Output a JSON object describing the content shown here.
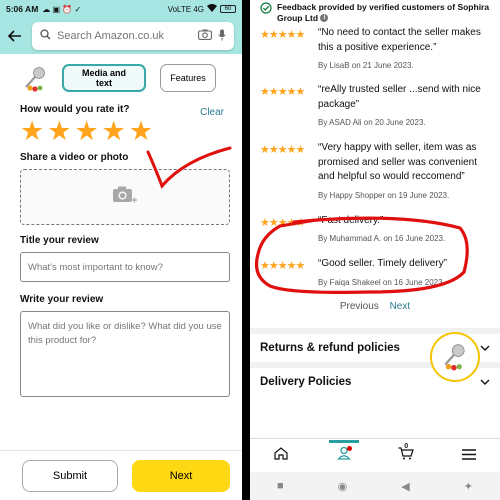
{
  "left": {
    "status": {
      "time": "5:06 AM",
      "left_icons": "☁ ▣ ⏰ ✓",
      "network": "VoLTE 4G",
      "battery": "60"
    },
    "search": {
      "placeholder": "Search Amazon.co.uk"
    },
    "tabs": [
      {
        "label": "Media and text",
        "active": true
      },
      {
        "label": "Features",
        "active": false
      }
    ],
    "rating": {
      "question": "How would you rate it?",
      "stars": 5,
      "clear_label": "Clear"
    },
    "upload": {
      "label": "Share a video or photo"
    },
    "title_field": {
      "label": "Title your review",
      "placeholder": "What's most important to know?"
    },
    "review_field": {
      "label": "Write your review",
      "placeholder": "What did you like or dislike? What did you use this product for?"
    },
    "buttons": {
      "submit": "Submit",
      "next": "Next"
    },
    "annotation_color": "#e0100f"
  },
  "right": {
    "feedback_header": "Feedback provided by verified customers of Sophira Group Ltd",
    "reviews": [
      {
        "stars": "★★★★★",
        "text": "“No need to contact the seller makes this a positive experience.”",
        "by": "By LisaB on 21 June 2023."
      },
      {
        "stars": "★★★★★",
        "text": "“reAlly trusted seller ...send with nice package”",
        "by": "By ASAD Ali on 20 June 2023."
      },
      {
        "stars": "★★★★★",
        "text": "“Very happy with seller, item was as promised and seller was convenient and helpful so would reccomend”",
        "by": "By Happy Shopper on 19 June 2023."
      },
      {
        "stars": "★★★★★",
        "text": "“Fast delivery.”",
        "by": "By Muhammad A. on 16 June 2023."
      },
      {
        "stars": "★★★★★",
        "text": "“Good seller. Timely delivery”",
        "by": "By Faiqa Shakeel on 16 June 2023."
      }
    ],
    "pager": {
      "previous": "Previous",
      "next": "Next"
    },
    "policies": [
      {
        "label": "Returns & refund policies"
      },
      {
        "label": "Delivery Policies"
      }
    ],
    "cart_count": "0",
    "annotation_color": "#e0100f"
  }
}
